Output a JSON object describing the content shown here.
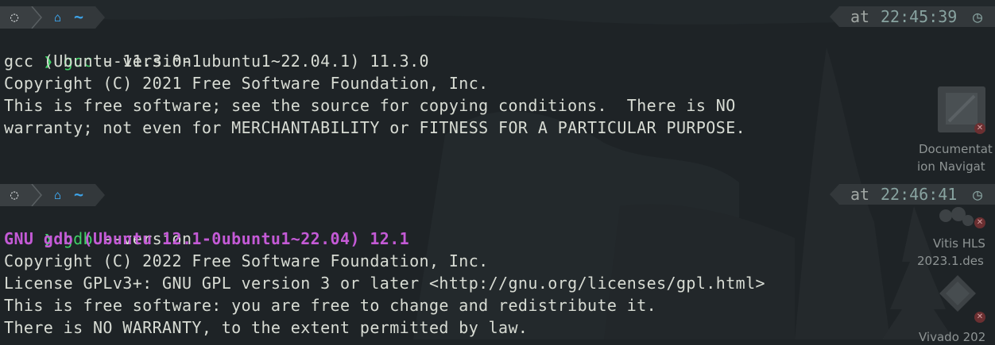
{
  "prompts": [
    {
      "home_glyph": "~",
      "status_prefix": "at",
      "time": "22:45:39",
      "prompt_char": "❯",
      "command": "gcc",
      "args": " --version"
    },
    {
      "home_glyph": "~",
      "status_prefix": "at",
      "time": "22:46:41",
      "prompt_char": "❯",
      "command": "gdb",
      "args": " --version"
    }
  ],
  "gcc_output": [
    "gcc (Ubuntu 11.3.0-1ubuntu1~22.04.1) 11.3.0",
    "Copyright (C) 2021 Free Software Foundation, Inc.",
    "This is free software; see the source for copying conditions.  There is NO",
    "warranty; not even for MERCHANTABILITY or FITNESS FOR A PARTICULAR PURPOSE."
  ],
  "gdb_output": {
    "header": "GNU gdb (Ubuntu 12.1-0ubuntu1~22.04) 12.1",
    "lines": [
      "Copyright (C) 2022 Free Software Foundation, Inc.",
      "License GPLv3+: GNU GPL version 3 or later <http://gnu.org/licenses/gpl.html>",
      "This is free software: you are free to change and redistribute it.",
      "There is NO WARRANTY, to the extent permitted by law."
    ]
  },
  "desktop_icons": [
    {
      "label_line1": "Documentat",
      "label_line2": "ion Navigat",
      "icon": "document-icon"
    },
    {
      "label_line1": "Vitis HLS",
      "label_line2": "2023.1.des",
      "icon": "vitis-icon"
    },
    {
      "label_line1": "Vivado 202",
      "label_line2": "",
      "icon": "vivado-icon"
    }
  ],
  "colors": {
    "background": "#1e2326",
    "prompt_green": "#3fd066",
    "gdb_magenta": "#c45ad6",
    "segment_gray": "#3a3f42",
    "home_blue": "#3da3e8"
  }
}
